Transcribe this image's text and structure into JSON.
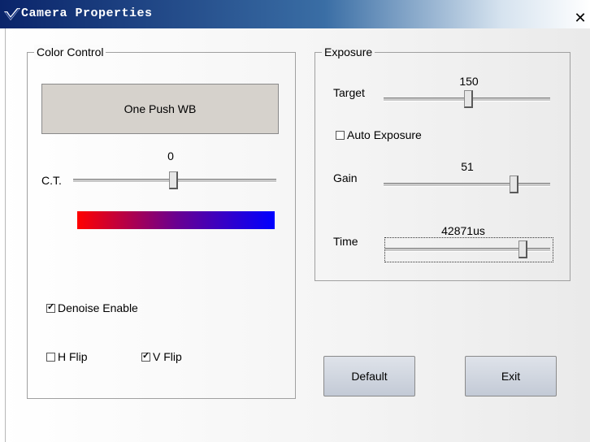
{
  "window": {
    "title": "Camera Properties",
    "close_label": "✕",
    "app_icon": "checkmark-app-icon"
  },
  "color_control": {
    "group_label": "Color Control",
    "one_push_wb_label": "One Push WB",
    "ct": {
      "label": "C.T.",
      "value": "0"
    },
    "denoise": {
      "label": "Denoise Enable",
      "checked": true
    },
    "h_flip": {
      "label": "H Flip",
      "checked": false
    },
    "v_flip": {
      "label": "V Flip",
      "checked": true
    }
  },
  "exposure": {
    "group_label": "Exposure",
    "target": {
      "label": "Target",
      "value": "150"
    },
    "auto_exposure": {
      "label": "Auto Exposure",
      "checked": false
    },
    "gain": {
      "label": "Gain",
      "value": "51"
    },
    "time": {
      "label": "Time",
      "value": "42871us"
    }
  },
  "buttons": {
    "default_label": "Default",
    "exit_label": "Exit"
  },
  "colors": {
    "gradient_start": "#ff0000",
    "gradient_end": "#0000ff",
    "title_bar": "#0a246a"
  }
}
